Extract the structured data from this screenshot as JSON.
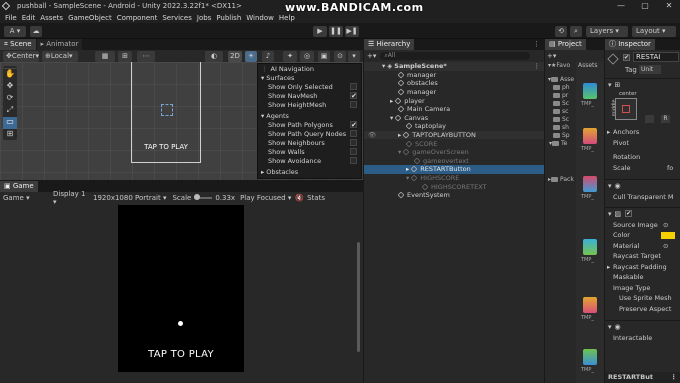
{
  "window": {
    "title": "pushball - SampleScene - Android - Unity 2022.3.22f1* <DX11>",
    "watermark": "www.BANDICAM.com"
  },
  "menu": [
    "File",
    "Edit",
    "Assets",
    "GameObject",
    "Component",
    "Services",
    "Jobs",
    "Publish",
    "Window",
    "Help"
  ],
  "toolbar": {
    "account": "A",
    "layers": "Layers",
    "layout": "Layout"
  },
  "scene": {
    "tab_scene": "Scene",
    "tab_animator": "Animator",
    "pivot": "Center",
    "space": "Local",
    "mode_2d": "2D",
    "canvas_text": "TAP TO PLAY",
    "ai": {
      "title": "AI Navigation",
      "surfaces": "Surfaces",
      "surface_items": [
        {
          "label": "Show Only Selected",
          "checked": ""
        },
        {
          "label": "Show NavMesh",
          "checked": "✔"
        },
        {
          "label": "Show HeightMesh",
          "checked": ""
        }
      ],
      "agents": "Agents",
      "agent_items": [
        {
          "label": "Show Path Polygons",
          "checked": "✔"
        },
        {
          "label": "Show Path Query Nodes",
          "checked": ""
        },
        {
          "label": "Show Neighbours",
          "checked": ""
        },
        {
          "label": "Show Walls",
          "checked": ""
        },
        {
          "label": "Show Avoidance",
          "checked": ""
        }
      ],
      "obstacles": "Obstacles"
    }
  },
  "game": {
    "tab": "Game",
    "mode": "Game",
    "display": "Display 1",
    "resolution": "1920x1080 Portrait",
    "scale_label": "Scale",
    "scale_value": "0.33x",
    "play_focused": "Play Focused",
    "stats": "Stats",
    "tap_text": "TAP TO PLAY"
  },
  "hierarchy": {
    "tab": "Hierarchy",
    "search": "All",
    "rows": [
      {
        "label": "SampleScene*",
        "indent": 0
      },
      {
        "label": "manager",
        "indent": 2
      },
      {
        "label": "obstacles",
        "indent": 2
      },
      {
        "label": "manager",
        "indent": 2
      },
      {
        "label": "player",
        "indent": 2
      },
      {
        "label": "Main Camera",
        "indent": 2
      },
      {
        "label": "Canvas",
        "indent": 2
      },
      {
        "label": "taptoplay",
        "indent": 3
      },
      {
        "label": "TAPTOPLAYBUTTON",
        "indent": 3
      },
      {
        "label": "SCORE",
        "indent": 3
      },
      {
        "label": "gameOverScreen",
        "indent": 3
      },
      {
        "label": "gameovertext",
        "indent": 4
      },
      {
        "label": "RESTARTButton",
        "indent": 4
      },
      {
        "label": "HIGHSCORE",
        "indent": 4
      },
      {
        "label": "HIGHSCORETEXT",
        "indent": 5
      },
      {
        "label": "EventSystem",
        "indent": 2
      }
    ]
  },
  "project": {
    "tab": "Project",
    "assets_crumb": "Assets",
    "favorites": "Favo",
    "tree": [
      "Asse",
      "ph",
      "pr",
      "Sc",
      "sc",
      "Sc",
      "sh",
      "Sp",
      "Te",
      "Pack"
    ],
    "file_labels": [
      "TMP_",
      "TMP_",
      "TMP_",
      "TMP_",
      "TMP_",
      "TMP_"
    ]
  },
  "inspector": {
    "tab": "Inspector",
    "object_name": "RESTAI",
    "tag_label": "Tag",
    "tag_value": "Unit",
    "anchor_label": "center",
    "middle_label": "middle",
    "rows_a": [
      "Anchors",
      "Pivot",
      "Rotation",
      "Scale"
    ],
    "scale_value": "fo",
    "cull": "Cull Transparent M",
    "rows_b": [
      "Source Image",
      "Color",
      "Material",
      "Raycast Target",
      "Raycast Padding",
      "Maskable",
      "Image Type"
    ],
    "sub_rows": [
      "Use Sprite Mesh",
      "Preserve Aspect"
    ],
    "interactable": "Interactable",
    "bottom_name": "RESTARTBut"
  }
}
